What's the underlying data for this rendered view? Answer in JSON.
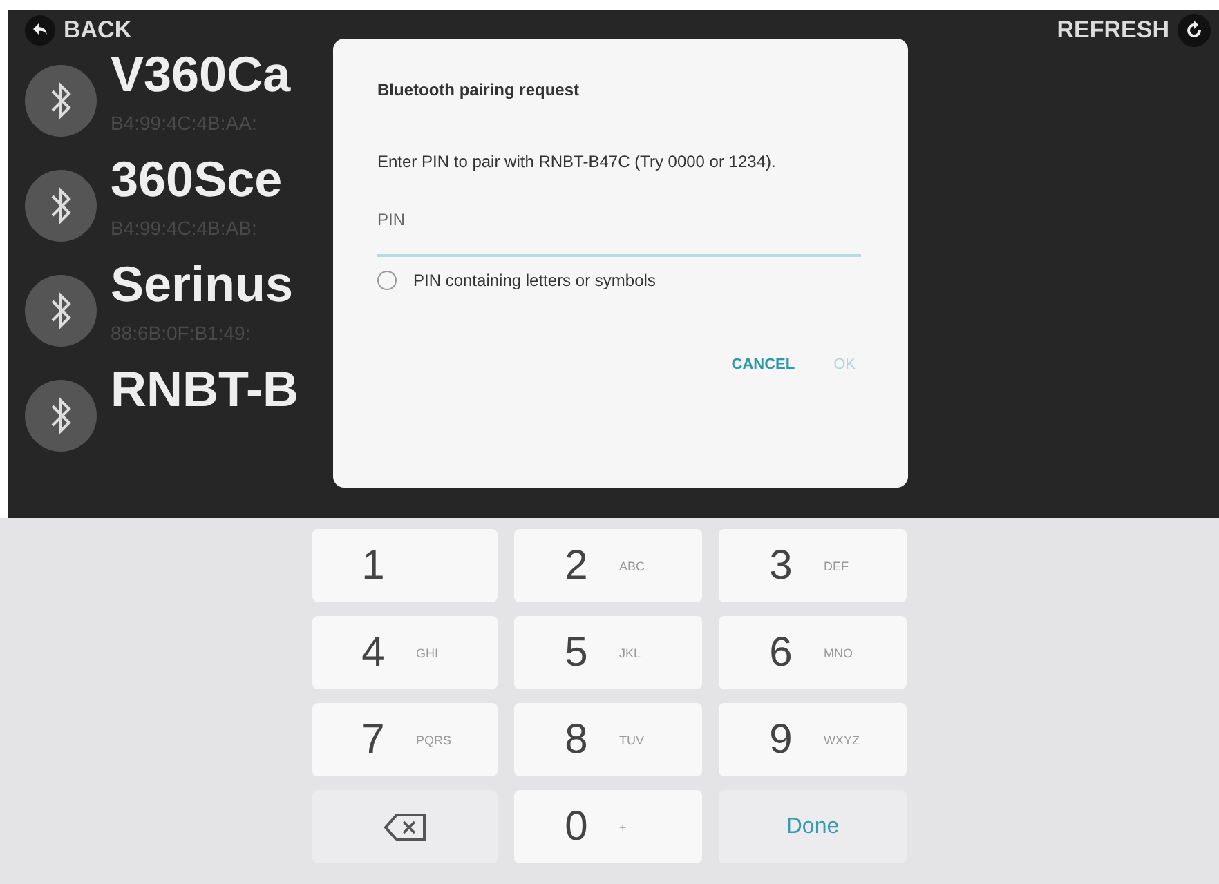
{
  "top_bar": {
    "back": "BACK",
    "refresh": "REFRESH"
  },
  "devices": [
    {
      "name": "V360Ca",
      "address": "B4:99:4C:4B:AA:"
    },
    {
      "name": "360Sce",
      "address": "B4:99:4C:4B:AB:"
    },
    {
      "name": "Serinus",
      "address": "88:6B:0F:B1:49:"
    },
    {
      "name": "RNBT-B"
    }
  ],
  "dialog": {
    "title": "Bluetooth pairing request",
    "message": "Enter PIN to pair with RNBT-B47C (Try 0000 or 1234).",
    "pin_field": {
      "placeholder": "PIN"
    },
    "option": {
      "label": "PIN containing letters or symbols",
      "checked": false
    },
    "buttons": [
      {
        "label": "CANCEL",
        "disabled": false
      },
      {
        "label": "OK",
        "disabled": true
      }
    ]
  },
  "keypad": [
    {
      "kind": "digit",
      "label": "1"
    },
    {
      "kind": "digit",
      "label": "2",
      "letters": "ABC"
    },
    {
      "kind": "digit",
      "label": "3",
      "letters": "DEF"
    },
    {
      "kind": "digit",
      "label": "4",
      "letters": "GHI"
    },
    {
      "kind": "digit",
      "label": "5",
      "letters": "JKL"
    },
    {
      "kind": "digit",
      "label": "6",
      "letters": "MNO"
    },
    {
      "kind": "digit",
      "label": "7",
      "letters": "PQRS"
    },
    {
      "kind": "digit",
      "label": "8",
      "letters": "TUV"
    },
    {
      "kind": "digit",
      "label": "9",
      "letters": "WXYZ"
    },
    {
      "kind": "backspace"
    },
    {
      "kind": "digit",
      "label": "0",
      "letters": "+"
    },
    {
      "kind": "done",
      "label": "Done"
    }
  ]
}
